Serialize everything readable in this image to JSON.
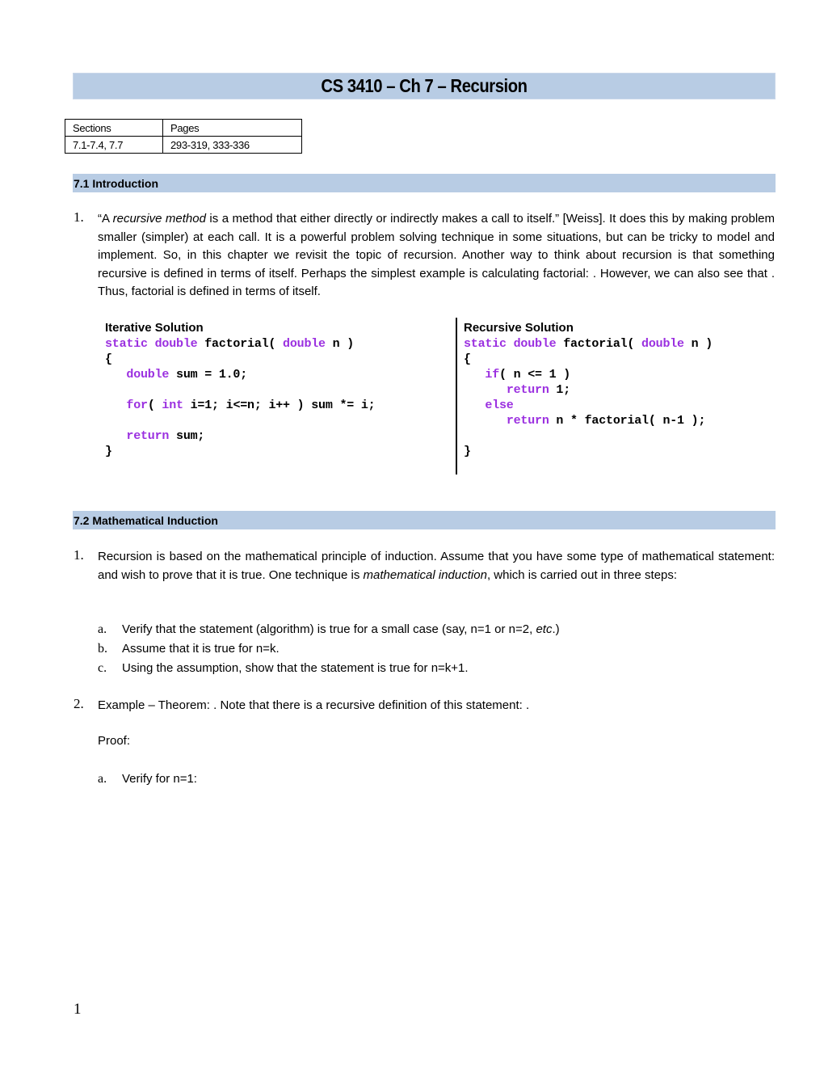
{
  "title": "CS 3410 – Ch 7 – Recursion",
  "sections_table": {
    "headers": [
      "Sections",
      "Pages"
    ],
    "rows": [
      [
        "7.1-7.4, 7.7",
        "293-319, 333-336"
      ]
    ]
  },
  "section_7_1": {
    "heading": "7.1 Introduction",
    "item1": {
      "number": "1.",
      "open_quote": "“A ",
      "emph": "recursive method",
      "text": " is a method that either directly or indirectly makes a call to itself.” [Weiss]. It does this by making problem smaller (simpler) at each call. It is a powerful problem solving technique in some situations, but can be tricky to model and implement. So, in this chapter we revisit the topic of recursion. Another way to think about recursion is that something recursive is defined in terms of itself. Perhaps the simplest example is calculating factorial: . However, we can also see that . Thus, factorial is defined in terms of itself."
    },
    "iterative": {
      "heading": "Iterative Solution",
      "lines": [
        [
          {
            "k": "static double"
          },
          {
            "t": " factorial( "
          },
          {
            "k": "double"
          },
          {
            "t": " n )"
          }
        ],
        [
          {
            "t": "{"
          }
        ],
        [
          {
            "t": "   "
          },
          {
            "k": "double"
          },
          {
            "t": " sum = 1.0;"
          }
        ],
        [
          {
            "t": ""
          }
        ],
        [
          {
            "t": "   "
          },
          {
            "k": "for"
          },
          {
            "t": "( "
          },
          {
            "k": "int"
          },
          {
            "t": " i=1; i<=n; i++ ) sum *= i;"
          }
        ],
        [
          {
            "t": ""
          }
        ],
        [
          {
            "t": "   "
          },
          {
            "k": "return"
          },
          {
            "t": " sum;"
          }
        ],
        [
          {
            "t": "}"
          }
        ]
      ]
    },
    "recursive": {
      "heading": "Recursive Solution",
      "lines": [
        [
          {
            "k": "static double"
          },
          {
            "t": " factorial( "
          },
          {
            "k": "double"
          },
          {
            "t": " n )"
          }
        ],
        [
          {
            "t": "{"
          }
        ],
        [
          {
            "t": "   "
          },
          {
            "k": "if"
          },
          {
            "t": "( n <= 1 )"
          }
        ],
        [
          {
            "t": "      "
          },
          {
            "k": "return"
          },
          {
            "t": " 1;"
          }
        ],
        [
          {
            "t": "   "
          },
          {
            "k": "else"
          }
        ],
        [
          {
            "t": "      "
          },
          {
            "k": "return"
          },
          {
            "t": " n * factorial( n-1 );"
          }
        ],
        [
          {
            "t": ""
          }
        ],
        [
          {
            "t": "}"
          }
        ]
      ]
    }
  },
  "section_7_2": {
    "heading": "7.2 Mathematical Induction",
    "item1": {
      "number": "1.",
      "text_before": "Recursion is based on the mathematical principle of induction. Assume that you have some type of mathematical statement:  and wish to prove that it is true. One technique is ",
      "emph": "mathematical induction",
      "text_after": ", which is carried out in three steps:",
      "steps": [
        {
          "label": "a.",
          "text": "Verify that the statement (algorithm) is true for a small case (say, n=1 or n=2, ",
          "emph": "etc",
          "tail": ".)"
        },
        {
          "label": "b.",
          "text": "Assume that it is true for n=k."
        },
        {
          "label": "c.",
          "text": "Using the assumption, show that the statement is true for n=k+1."
        }
      ]
    },
    "item2": {
      "number": "2.",
      "text": "Example – Theorem: . Note that there is a recursive definition of this statement: .",
      "proof_label": "Proof:",
      "proof_steps": [
        {
          "label": "a.",
          "text": "Verify for n=1:"
        }
      ]
    }
  },
  "page_number": "1"
}
